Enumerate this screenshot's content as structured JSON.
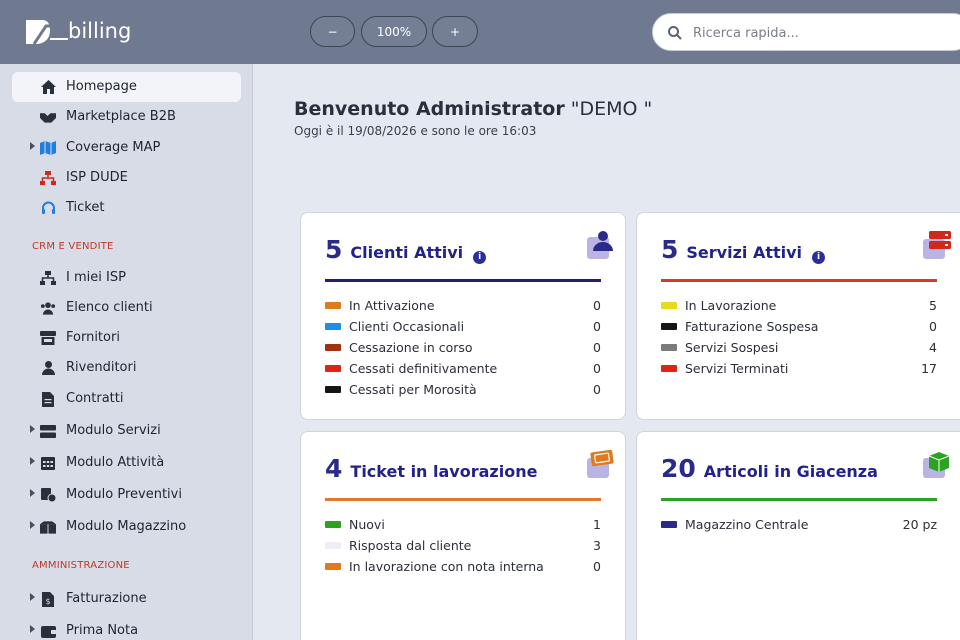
{
  "header": {
    "logo_text": "billing",
    "zoom_out_label": "−",
    "zoom_level": "100%",
    "zoom_in_label": "+",
    "search_placeholder": "Ricerca rapida..."
  },
  "sidebar": {
    "items_top": [
      {
        "label": "Homepage",
        "icon": "home-icon",
        "active": true,
        "caret": false
      },
      {
        "label": "Marketplace B2B",
        "icon": "handshake-icon",
        "active": false,
        "caret": false
      },
      {
        "label": "Coverage MAP",
        "icon": "map-icon",
        "active": false,
        "caret": true
      },
      {
        "label": "ISP DUDE",
        "icon": "network-icon",
        "active": false,
        "caret": false
      },
      {
        "label": "Ticket",
        "icon": "headset-icon",
        "active": false,
        "caret": false
      }
    ],
    "section_crm": "CRM E VENDITE",
    "items_crm": [
      {
        "label": "I miei ISP",
        "icon": "network-icon",
        "caret": false
      },
      {
        "label": "Elenco clienti",
        "icon": "users-icon",
        "caret": false
      },
      {
        "label": "Fornitori",
        "icon": "store-icon",
        "caret": false
      },
      {
        "label": "Rivenditori",
        "icon": "user-tie-icon",
        "caret": false
      },
      {
        "label": "Contratti",
        "icon": "document-icon",
        "caret": false
      },
      {
        "label": "Modulo Servizi",
        "icon": "server-icon",
        "caret": true
      },
      {
        "label": "Modulo Attività",
        "icon": "calendar-icon",
        "caret": true
      },
      {
        "label": "Modulo Preventivi",
        "icon": "quote-icon",
        "caret": true
      },
      {
        "label": "Modulo Magazzino",
        "icon": "boxes-icon",
        "caret": true
      }
    ],
    "section_admin": "AMMINISTRAZIONE",
    "items_admin": [
      {
        "label": "Fatturazione",
        "icon": "invoice-icon",
        "caret": true
      },
      {
        "label": "Prima Nota",
        "icon": "wallet-icon",
        "caret": true
      }
    ]
  },
  "main": {
    "welcome_bold": "Benvenuto Administrator",
    "welcome_name": "\"DEMO \"",
    "date_text": "Oggi è il 19/08/2026 e sono le ore 16:03"
  },
  "cards": {
    "clienti": {
      "count": "5",
      "title": "Clienti Attivi",
      "rule_color": "#23206a",
      "rows": [
        {
          "label": "In Attivazione",
          "value": "0",
          "color": "#e07a1f"
        },
        {
          "label": "Clienti Occasionali",
          "value": "0",
          "color": "#1e8fe0"
        },
        {
          "label": "Cessazione in corso",
          "value": "0",
          "color": "#a1320f"
        },
        {
          "label": "Cessati definitivamente",
          "value": "0",
          "color": "#dd2416"
        },
        {
          "label": "Cessati per Morosità",
          "value": "0",
          "color": "#151515"
        }
      ]
    },
    "servizi": {
      "count": "5",
      "title": "Servizi Attivi",
      "rule_color": "#d63a2a",
      "rows": [
        {
          "label": "In Lavorazione",
          "value": "5",
          "color": "#e6dc1e"
        },
        {
          "label": "Fatturazione Sospesa",
          "value": "0",
          "color": "#151515"
        },
        {
          "label": "Servizi Sospesi",
          "value": "4",
          "color": "#7b7b7b"
        },
        {
          "label": "Servizi Terminati",
          "value": "17",
          "color": "#dd2416"
        }
      ]
    },
    "ticket": {
      "count": "4",
      "title": "Ticket in lavorazione",
      "rule_color": "#e07a2a",
      "rows": [
        {
          "label": "Nuovi",
          "value": "1",
          "color": "#2aa31e"
        },
        {
          "label": "Risposta dal cliente",
          "value": "3",
          "color": "#eeeef8"
        },
        {
          "label": "In lavorazione con nota interna",
          "value": "0",
          "color": "#e07a1f"
        }
      ]
    },
    "articoli": {
      "count": "20",
      "title": "Articoli in Giacenza",
      "rule_color": "#2aa31e",
      "rows": [
        {
          "label": "Magazzino Centrale",
          "value": "20 pz",
          "color": "#2a2a8a"
        }
      ]
    }
  }
}
